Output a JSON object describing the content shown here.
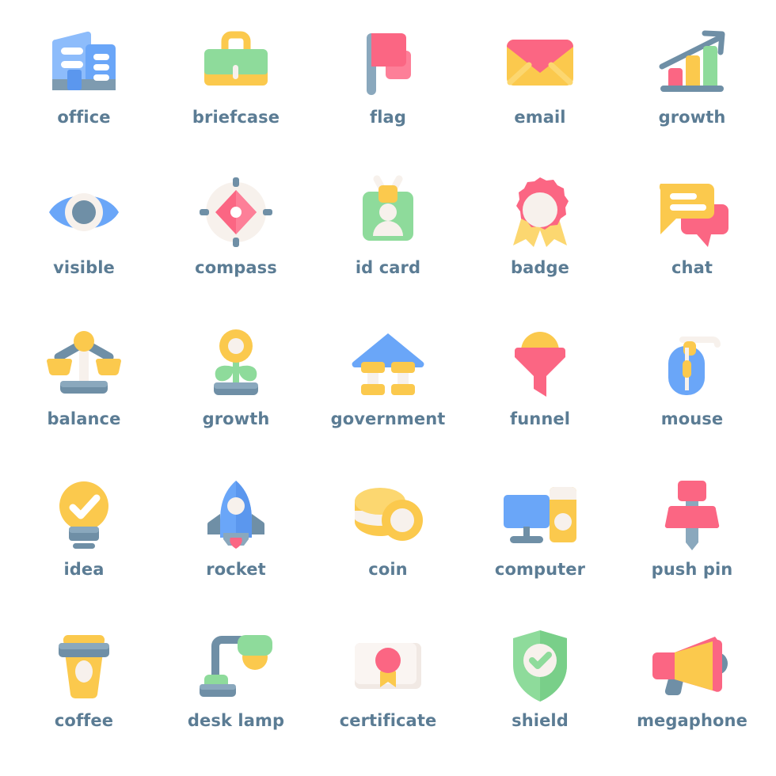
{
  "sheet": {
    "background": "#ffffff",
    "label_color": "#5b7c94",
    "columns": 5,
    "rows": 5,
    "total_icons": 25
  },
  "palette": {
    "blue": "#6aa6f8",
    "blue_dark": "#5b97ee",
    "blue_light": "#8dbcfb",
    "slate": "#6f8fa6",
    "slate_dark": "#5f819a",
    "slate_light": "#8aa8bd",
    "green": "#8edb9b",
    "green_dark": "#79cf89",
    "green_light": "#a6e5b0",
    "yellow": "#fbc94d",
    "yellow_light": "#fcd770",
    "yellow_dark": "#f6bb33",
    "pink": "#fb6683",
    "pink_light": "#fd7f98",
    "pink_dark": "#f4607c",
    "cream": "#f7f1ec",
    "white": "#ffffff"
  },
  "icons": [
    {
      "id": "office",
      "label": "office",
      "row": 1,
      "col": 1,
      "colors": [
        "#6aa6f8",
        "#8dbcfb",
        "#6f8fa6",
        "#ffffff"
      ]
    },
    {
      "id": "briefcase",
      "label": "briefcase",
      "row": 1,
      "col": 2,
      "colors": [
        "#8edb9b",
        "#fbc94d",
        "#f7f1ec"
      ]
    },
    {
      "id": "flag",
      "label": "flag",
      "row": 1,
      "col": 3,
      "colors": [
        "#fb6683",
        "#fd7f98",
        "#8aa8bd"
      ]
    },
    {
      "id": "email",
      "label": "email",
      "row": 1,
      "col": 4,
      "colors": [
        "#fbc94d",
        "#fb6683",
        "#fcd770"
      ]
    },
    {
      "id": "growth",
      "label": "growth",
      "row": 1,
      "col": 5,
      "colors": [
        "#6f8fa6",
        "#fb6683",
        "#fbc94d",
        "#8edb9b"
      ]
    },
    {
      "id": "visible",
      "label": "visible",
      "row": 2,
      "col": 1,
      "colors": [
        "#6aa6f8",
        "#f7f1ec",
        "#6f8fa6"
      ]
    },
    {
      "id": "compass",
      "label": "compass",
      "row": 2,
      "col": 2,
      "colors": [
        "#f7f1ec",
        "#fb6683",
        "#6f8fa6"
      ]
    },
    {
      "id": "id-card",
      "label": "id card",
      "row": 2,
      "col": 3,
      "colors": [
        "#8edb9b",
        "#fbc94d",
        "#f7f1ec"
      ]
    },
    {
      "id": "badge",
      "label": "badge",
      "row": 2,
      "col": 4,
      "colors": [
        "#fb6683",
        "#fcd770",
        "#f7f1ec"
      ]
    },
    {
      "id": "chat",
      "label": "chat",
      "row": 2,
      "col": 5,
      "colors": [
        "#fbc94d",
        "#fb6683",
        "#ffffff"
      ]
    },
    {
      "id": "balance",
      "label": "balance",
      "row": 3,
      "col": 1,
      "colors": [
        "#6f8fa6",
        "#fbc94d",
        "#f7f1ec"
      ]
    },
    {
      "id": "growth-plant",
      "label": "growth",
      "row": 3,
      "col": 2,
      "colors": [
        "#fbc94d",
        "#8edb9b",
        "#6f8fa6"
      ]
    },
    {
      "id": "government",
      "label": "government",
      "row": 3,
      "col": 3,
      "colors": [
        "#6aa6f8",
        "#fbc94d",
        "#f7f1ec"
      ]
    },
    {
      "id": "funnel",
      "label": "funnel",
      "row": 3,
      "col": 4,
      "colors": [
        "#fb6683",
        "#fbc94d"
      ]
    },
    {
      "id": "mouse",
      "label": "mouse",
      "row": 3,
      "col": 5,
      "colors": [
        "#6aa6f8",
        "#fbc94d",
        "#f7f1ec"
      ]
    },
    {
      "id": "idea",
      "label": "idea",
      "row": 4,
      "col": 1,
      "colors": [
        "#fbc94d",
        "#6f8fa6",
        "#ffffff"
      ]
    },
    {
      "id": "rocket",
      "label": "rocket",
      "row": 4,
      "col": 2,
      "colors": [
        "#6aa6f8",
        "#6f8fa6",
        "#fb6683",
        "#f7f1ec"
      ]
    },
    {
      "id": "coin",
      "label": "coin",
      "row": 4,
      "col": 3,
      "colors": [
        "#fbc94d",
        "#fcd770",
        "#f7f1ec"
      ]
    },
    {
      "id": "computer",
      "label": "computer",
      "row": 4,
      "col": 4,
      "colors": [
        "#6aa6f8",
        "#fbc94d",
        "#6f8fa6",
        "#f7f1ec"
      ]
    },
    {
      "id": "push-pin",
      "label": "push pin",
      "row": 4,
      "col": 5,
      "colors": [
        "#fb6683",
        "#6f8fa6"
      ]
    },
    {
      "id": "coffee",
      "label": "coffee",
      "row": 5,
      "col": 1,
      "colors": [
        "#fbc94d",
        "#6f8fa6",
        "#f7f1ec"
      ]
    },
    {
      "id": "desk-lamp",
      "label": "desk lamp",
      "row": 5,
      "col": 2,
      "colors": [
        "#8edb9b",
        "#6f8fa6",
        "#fbc94d"
      ]
    },
    {
      "id": "certificate",
      "label": "certificate",
      "row": 5,
      "col": 3,
      "colors": [
        "#f7f1ec",
        "#fb6683",
        "#fbc94d"
      ]
    },
    {
      "id": "shield",
      "label": "shield",
      "row": 5,
      "col": 4,
      "colors": [
        "#8edb9b",
        "#f7f1ec"
      ]
    },
    {
      "id": "megaphone",
      "label": "megaphone",
      "row": 5,
      "col": 5,
      "colors": [
        "#fbc94d",
        "#fb6683",
        "#6f8fa6"
      ]
    }
  ]
}
